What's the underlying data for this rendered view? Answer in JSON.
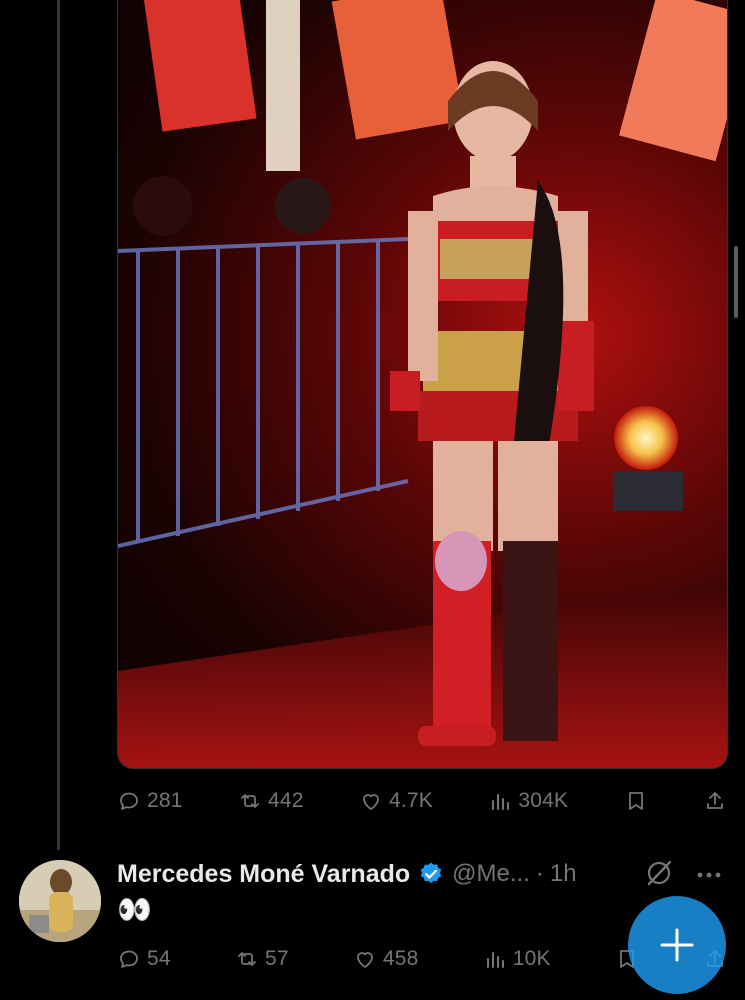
{
  "tweet1": {
    "replies": "281",
    "reposts": "442",
    "likes": "4.7K",
    "views": "304K"
  },
  "tweet2": {
    "display_name": "Mercedes Moné Varnado",
    "handle": "@Me...",
    "separator": "·",
    "time": "1h",
    "text": "👀",
    "replies": "54",
    "reposts": "57",
    "likes": "458",
    "views": "10K"
  },
  "colors": {
    "background": "#000000",
    "muted_text": "#71767b",
    "primary_text": "#e7e9ea",
    "verified_blue": "#1d9bf0",
    "fab": "#1d9bf0"
  },
  "icons": [
    "reply-icon",
    "repost-icon",
    "like-icon",
    "views-icon",
    "bookmark-icon",
    "share-icon",
    "verified-badge-icon",
    "grok-icon",
    "more-icon",
    "compose-plus-icon"
  ]
}
